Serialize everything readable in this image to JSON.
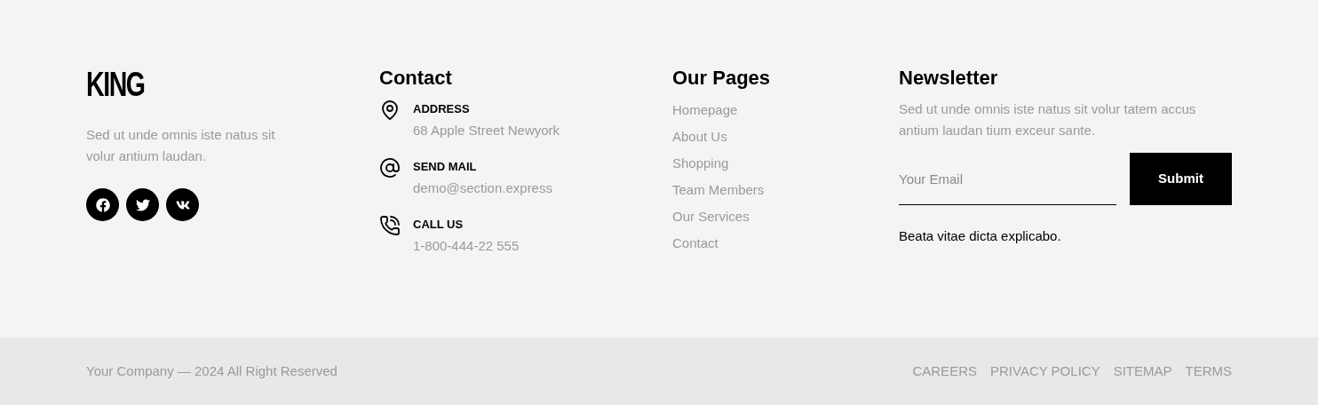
{
  "brand": {
    "logo": "KING",
    "description": "Sed ut unde omnis iste natus sit volur antium laudan.",
    "social": [
      {
        "kind": "facebook"
      },
      {
        "kind": "twitter"
      },
      {
        "kind": "vk"
      }
    ]
  },
  "contact": {
    "title": "Contact",
    "items": [
      {
        "kind": "address",
        "label": "ADDRESS",
        "value": "68 Apple Street Newyork"
      },
      {
        "kind": "mail",
        "label": "SEND MAIL",
        "value": "demo@section.express"
      },
      {
        "kind": "phone",
        "label": "CALL US",
        "value": "1-800-444-22 555"
      }
    ]
  },
  "pages": {
    "title": "Our Pages",
    "links": [
      "Homepage",
      "About Us",
      "Shopping",
      "Team Members",
      "Our Services",
      "Contact"
    ]
  },
  "newsletter": {
    "title": "Newsletter",
    "description": "Sed ut unde omnis iste natus sit volur tatem accus antium laudan tium exceur sante.",
    "email": {
      "placeholder": "Your Email"
    },
    "button": "Submit",
    "note": "Beata vitae dicta explicabo."
  },
  "bottom_bar": {
    "copyright": "Your Company — 2024 All Right Reserved",
    "links": [
      "CAREERS",
      "PRIVACY POLICY",
      "SITEMAP",
      "TERMS"
    ]
  }
}
